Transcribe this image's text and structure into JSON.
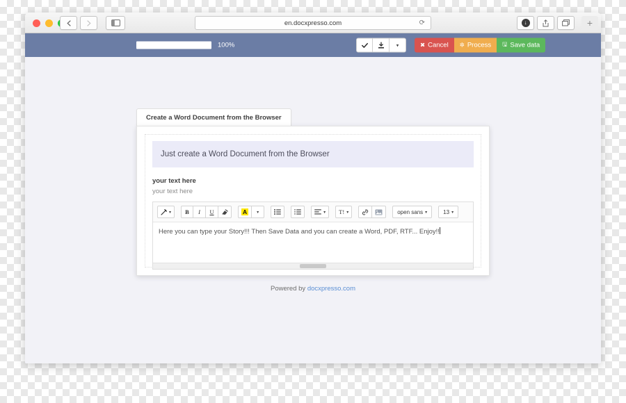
{
  "browser": {
    "url": "en.docxpresso.com",
    "back_icon": "chevron-left-icon",
    "forward_icon": "chevron-right-icon",
    "sidebar_icon": "sidebar-toggle-icon",
    "reload_icon": "reload-icon",
    "downloads_icon": "downloads-icon",
    "share_icon": "share-icon",
    "tabs_icon": "show-tabs-icon",
    "newtab_label": "+"
  },
  "appbar": {
    "progress_percent": "100%",
    "progress_value": 100,
    "confirm_icon": "check-icon",
    "download_icon": "download-icon",
    "download_caret": "▾",
    "cancel_label": "Cancel",
    "cancel_icon": "close-icon",
    "process_label": "Process",
    "process_icon": "gear-icon",
    "save_label": "Save data",
    "save_icon": "floppy-disk-icon",
    "colors": {
      "bar": "#6b7da5",
      "cancel": "#d9534f",
      "process": "#f0ad4e",
      "save": "#5cb85c"
    }
  },
  "page": {
    "tab_label": "Create a Word Document from the Browser",
    "tab_accent": "#3f9c35",
    "banner_title": "Just create a Word Document from the Browser",
    "field_label": "your text here",
    "field_description": "your text here",
    "footer_prefix": "Powered by ",
    "footer_link": "docxpresso.com"
  },
  "editor": {
    "content": "Here you can type your Story!!! Then Save Data and you can create a Word, PDF, RTF... Enjoy!!",
    "toolbar": {
      "style_label": "✐",
      "bold_label": "B",
      "italic_label": "I",
      "underline_label": "U",
      "eraser_label": "✦",
      "highlight_label": "A",
      "highlight_color": "#ffe800",
      "bullet_list_icon": "bullet-list-icon",
      "number_list_icon": "numbered-list-icon",
      "align_icon": "align-left-icon",
      "table_label": "T!",
      "link_icon": "link-icon",
      "image_icon": "image-icon",
      "font_family": "open sans",
      "font_size": "13",
      "caret": "▾"
    }
  }
}
